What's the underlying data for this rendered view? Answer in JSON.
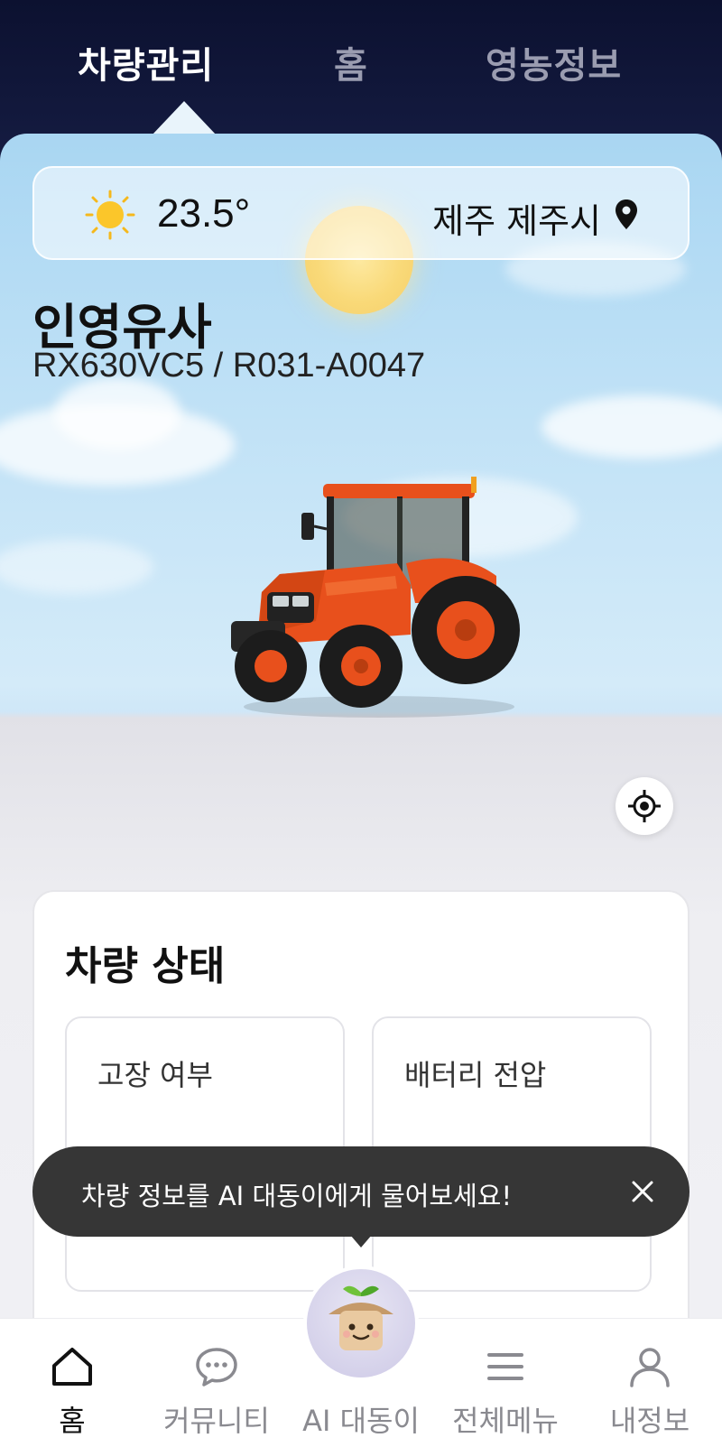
{
  "top_tabs": [
    {
      "label": "차량관리",
      "active": true
    },
    {
      "label": "홈",
      "active": false
    },
    {
      "label": "영농정보",
      "active": false
    }
  ],
  "weather": {
    "icon": "sun-icon",
    "temperature": "23.5°",
    "location": "제주 제주시"
  },
  "vehicle": {
    "owner_name": "인영유사",
    "model_serial": "RX630VC5  / R031-A0047"
  },
  "status_card": {
    "title": "차량 상태",
    "tiles": [
      {
        "label": "고장 여부"
      },
      {
        "label": "배터리 전압"
      }
    ]
  },
  "toast": {
    "message": "차량 정보를 AI 대동이에게 물어보세요!"
  },
  "bottom_nav": [
    {
      "label": "홈",
      "icon": "home-icon",
      "active": true
    },
    {
      "label": "커뮤니티",
      "icon": "chat-icon",
      "active": false
    },
    {
      "label": "AI 대동이",
      "icon": "ai-avatar",
      "active": false
    },
    {
      "label": "전체메뉴",
      "icon": "menu-icon",
      "active": false
    },
    {
      "label": "내정보",
      "icon": "profile-icon",
      "active": false
    }
  ],
  "colors": {
    "header_bg": "#0c1130",
    "tractor_orange": "#e8501c",
    "toast_bg": "#363636"
  }
}
